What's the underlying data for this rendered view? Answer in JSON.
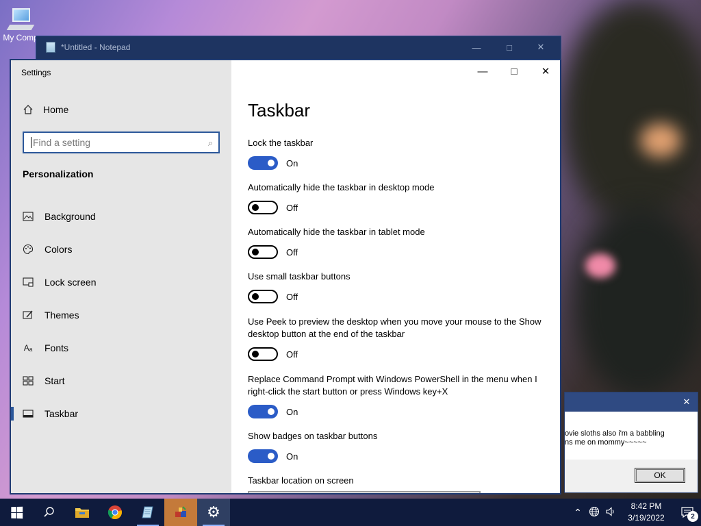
{
  "desktop": {
    "icon_label": "My Comp"
  },
  "notepad": {
    "title": "*Untitled - Notepad",
    "minimize": "—",
    "maximize": "□",
    "close": "✕"
  },
  "settings": {
    "app_title": "Settings",
    "home_label": "Home",
    "search_placeholder": "Find a setting",
    "section_label": "Personalization",
    "nav": [
      {
        "label": "Background",
        "icon": "background-icon"
      },
      {
        "label": "Colors",
        "icon": "palette-icon"
      },
      {
        "label": "Lock screen",
        "icon": "lock-screen-icon"
      },
      {
        "label": "Themes",
        "icon": "themes-icon"
      },
      {
        "label": "Fonts",
        "icon": "fonts-icon"
      },
      {
        "label": "Start",
        "icon": "start-icon"
      },
      {
        "label": "Taskbar",
        "icon": "taskbar-icon",
        "active": true
      }
    ],
    "page_title": "Taskbar",
    "items": [
      {
        "label": "Lock the taskbar",
        "state": "On"
      },
      {
        "label": "Automatically hide the taskbar in desktop mode",
        "state": "Off"
      },
      {
        "label": "Automatically hide the taskbar in tablet mode",
        "state": "Off"
      },
      {
        "label": "Use small taskbar buttons",
        "state": "Off"
      },
      {
        "label": "Use Peek to preview the desktop when you move your mouse to the Show desktop button at the end of the taskbar",
        "state": "Off"
      },
      {
        "label": "Replace Command Prompt with Windows PowerShell in the menu when I right-click the start button or press Windows key+X",
        "state": "On"
      },
      {
        "label": "Show badges on taskbar buttons",
        "state": "On"
      }
    ],
    "location_label": "Taskbar location on screen",
    "minimize": "—",
    "maximize": "□",
    "close": "✕"
  },
  "dialog": {
    "line1": "ovie sloths also i'm a babbling",
    "line2": "ns me on mommy~~~~~",
    "ok_label": "OK",
    "close": "✕"
  },
  "taskbar": {
    "time": "8:42 PM",
    "date": "3/19/2022",
    "notification_count": "2"
  },
  "colors": {
    "accent": "#2b5cc7",
    "taskbar": "#0f1b3d",
    "window_border": "#1f3b73"
  }
}
